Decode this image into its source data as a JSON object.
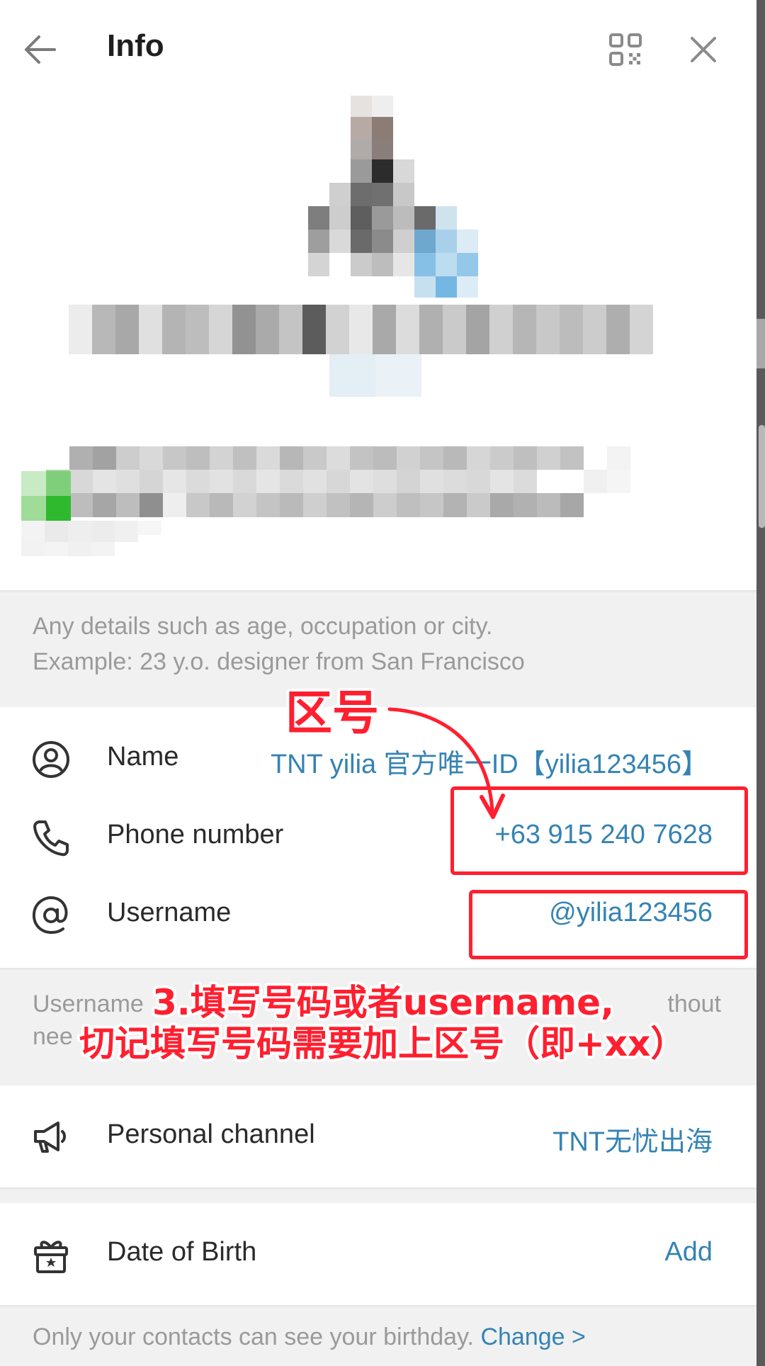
{
  "header": {
    "title": "Info"
  },
  "bio": {
    "hint_line1": "Any details such as age, occupation or city.",
    "hint_line2": "Example: 23 y.o. designer from San Francisco"
  },
  "info_rows": {
    "name_label": "Name",
    "name_value": "TNT yilia 官方唯一ID【yilia123456】",
    "phone_label": "Phone number",
    "phone_value": "+63 915 240 7628",
    "username_label": "Username",
    "username_value": "@yilia123456"
  },
  "username_hint": {
    "visible_start": "Username",
    "visible_end": "thout",
    "visible_line2": "nee"
  },
  "channel": {
    "label": "Personal channel",
    "value": "TNT无忧出海"
  },
  "birth": {
    "label": "Date of Birth",
    "action": "Add",
    "note": "Only your contacts can see your birthday.",
    "change_link": "Change >"
  },
  "annotations": {
    "area_code_label": "区号",
    "instruction_line1": "3.填写号码或者username,",
    "instruction_line2": "切记填写号码需要加上区号（即+xx）"
  },
  "colors": {
    "accent_blue": "#3583b3",
    "annotation_red": "#ff1f2f",
    "section_gray": "#f1f1f1"
  },
  "icons": {
    "back": "arrow-left-icon",
    "qr": "qr-code-icon",
    "close": "close-icon",
    "name": "user-circle-icon",
    "phone": "phone-icon",
    "username": "at-sign-icon",
    "channel": "megaphone-icon",
    "birth": "gift-icon"
  }
}
